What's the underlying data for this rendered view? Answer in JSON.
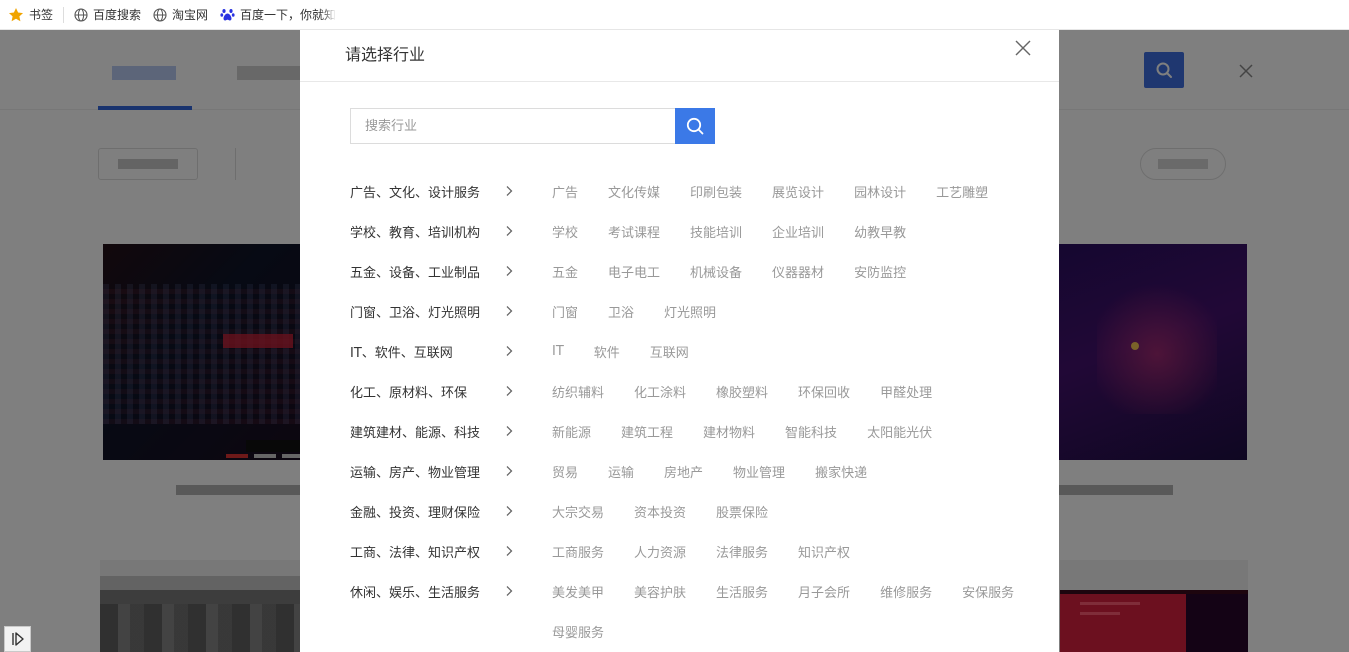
{
  "bookmarks": {
    "items": [
      {
        "label": "书签",
        "icon": "star-icon"
      },
      {
        "label": "百度搜索",
        "icon": "globe-icon"
      },
      {
        "label": "淘宝网",
        "icon": "globe-icon"
      },
      {
        "label": "百度一下，你就知",
        "icon": "baidu-paw-icon"
      }
    ]
  },
  "modal": {
    "title": "请选择行业",
    "search_placeholder": "搜索行业",
    "categories": [
      {
        "name": "广告、文化、设计服务",
        "subs": [
          "广告",
          "文化传媒",
          "印刷包装",
          "展览设计",
          "园林设计",
          "工艺雕塑"
        ]
      },
      {
        "name": "学校、教育、培训机构",
        "subs": [
          "学校",
          "考试课程",
          "技能培训",
          "企业培训",
          "幼教早教"
        ]
      },
      {
        "name": "五金、设备、工业制品",
        "subs": [
          "五金",
          "电子电工",
          "机械设备",
          "仪器器材",
          "安防监控"
        ]
      },
      {
        "name": "门窗、卫浴、灯光照明",
        "subs": [
          "门窗",
          "卫浴",
          "灯光照明"
        ]
      },
      {
        "name": "IT、软件、互联网",
        "subs": [
          "IT",
          "软件",
          "互联网"
        ]
      },
      {
        "name": "化工、原材料、环保",
        "subs": [
          "纺织辅料",
          "化工涂料",
          "橡胶塑料",
          "环保回收",
          "甲醛处理"
        ]
      },
      {
        "name": "建筑建材、能源、科技",
        "subs": [
          "新能源",
          "建筑工程",
          "建材物料",
          "智能科技",
          "太阳能光伏"
        ]
      },
      {
        "name": "运输、房产、物业管理",
        "subs": [
          "贸易",
          "运输",
          "房地产",
          "物业管理",
          "搬家快递"
        ]
      },
      {
        "name": "金融、投资、理财保险",
        "subs": [
          "大宗交易",
          "资本投资",
          "股票保险"
        ]
      },
      {
        "name": "工商、法律、知识产权",
        "subs": [
          "工商服务",
          "人力资源",
          "法律服务",
          "知识产权"
        ]
      },
      {
        "name": "休闲、娱乐、生活服务",
        "subs": [
          "美发美甲",
          "美容护肤",
          "生活服务",
          "月子会所",
          "维修服务",
          "安保服务"
        ]
      },
      {
        "name": "",
        "subs": [
          "母婴服务"
        ]
      }
    ]
  },
  "colors": {
    "accent": "#3b79e7",
    "overlay": "rgba(0,0,0,0.5)",
    "sub_text": "#999999",
    "cat_text": "#333333"
  }
}
